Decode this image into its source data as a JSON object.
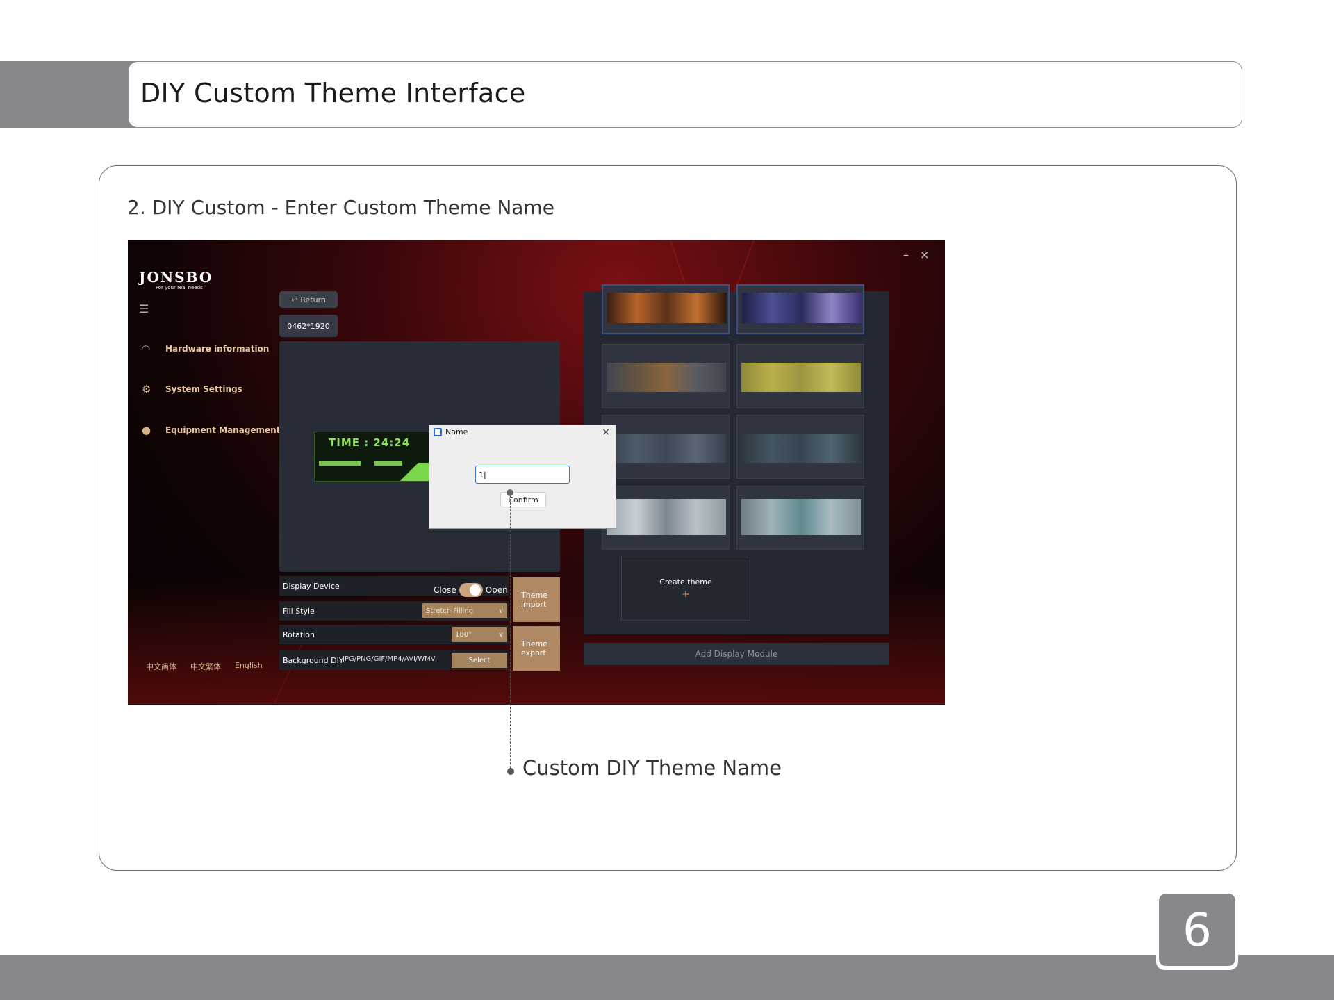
{
  "page": {
    "title": "DIY Custom Theme Interface",
    "step": "2. DIY Custom - Enter Custom Theme Name",
    "callout": "Custom DIY Theme Name",
    "page_number": "6"
  },
  "app": {
    "window_controls": {
      "minimize": "–",
      "close": "×"
    },
    "logo": "JONSBO",
    "logo_tagline": "For your real needs",
    "sidebar": [
      {
        "icon": "speedometer-icon",
        "label": "Hardware information"
      },
      {
        "icon": "gear-icon",
        "label": "System Settings"
      },
      {
        "icon": "person-icon",
        "label": "Equipment Management"
      }
    ],
    "languages": [
      "中文简体",
      "中文繁体",
      "English"
    ],
    "return_label": "Return",
    "resolution": "0462*1920",
    "mini_preview_time": "TIME : 24:24",
    "display_device": {
      "label": "Display Device",
      "off": "Close",
      "on": "Open",
      "value": "Open"
    },
    "fill_style": {
      "label": "Fill Style",
      "value": "Stretch Filling"
    },
    "rotation": {
      "label": "Rotation",
      "value": "180°"
    },
    "background_diy": {
      "label": "Background DIY",
      "formats": "JPG/PNG/GIF/MP4/AVI/WMV",
      "button": "Select"
    },
    "theme_import": "Theme import",
    "theme_export": "Theme export",
    "create_theme": "Create theme",
    "create_plus": "+",
    "add_display_module": "Add Display Module",
    "dialog": {
      "title": "Name",
      "close": "×",
      "input_value": "1|",
      "confirm": "Confirm"
    }
  }
}
